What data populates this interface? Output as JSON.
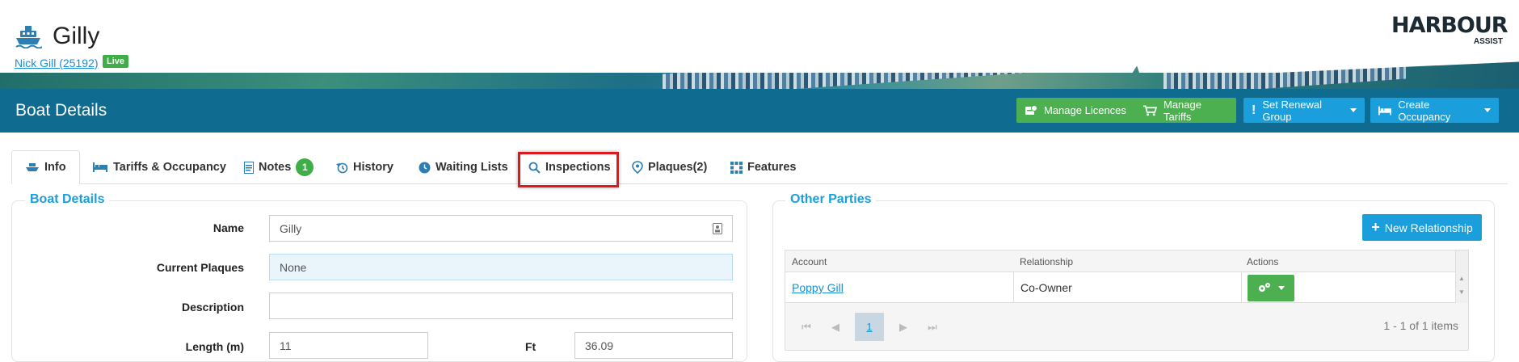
{
  "header": {
    "title": "Gilly",
    "owner_link": "Nick Gill (25192)",
    "status_badge": "Live",
    "logo_main": "HARBOUR",
    "logo_sub": "ASSIST"
  },
  "panel": {
    "title": "Boat Details",
    "buttons": [
      {
        "label": "Manage Licences",
        "icon": "licence-icon",
        "color": "#4cb050"
      },
      {
        "label": "Manage Tariffs",
        "icon": "cart-icon",
        "color": "#4cb050"
      },
      {
        "label": "Set Renewal Group",
        "icon": "exclamation-icon",
        "color": "#1a9fdc"
      },
      {
        "label": "Create Occupancy",
        "icon": "bed-icon",
        "color": "#1a9fdc"
      }
    ]
  },
  "tabs": [
    {
      "label": "Info",
      "icon": "boat-icon",
      "active": true
    },
    {
      "label": "Tariffs & Occupancy",
      "icon": "bed-icon"
    },
    {
      "label": "Notes",
      "icon": "note-icon",
      "count": "1"
    },
    {
      "label": "History",
      "icon": "history-icon"
    },
    {
      "label": "Waiting Lists",
      "icon": "clock-icon"
    },
    {
      "label": "Inspections",
      "icon": "search-icon"
    },
    {
      "label": "Plaques(2)",
      "icon": "plaque-icon"
    },
    {
      "label": "Features",
      "icon": "grid-icon"
    }
  ],
  "boat_details": {
    "legend": "Boat Details",
    "name_label": "Name",
    "name_value": "Gilly",
    "plaques_label": "Current Plaques",
    "plaques_value": "None",
    "description_label": "Description",
    "description_value": "",
    "length_label": "Length (m)",
    "length_value": "11",
    "ft_label": "Ft",
    "ft_value": "36.09"
  },
  "other_parties": {
    "legend": "Other Parties",
    "new_button": "New Relationship",
    "columns": [
      "Account",
      "Relationship",
      "Actions"
    ],
    "rows": [
      {
        "account": "Poppy Gill",
        "relationship": "Co-Owner"
      }
    ],
    "pager": {
      "current_page": "1",
      "info": "1 - 1 of 1 items"
    }
  },
  "colors": {
    "accent": "#1a9fdc",
    "header_bar": "#0f6b8f",
    "success": "#4cb050",
    "highlight": "#e0171d"
  }
}
